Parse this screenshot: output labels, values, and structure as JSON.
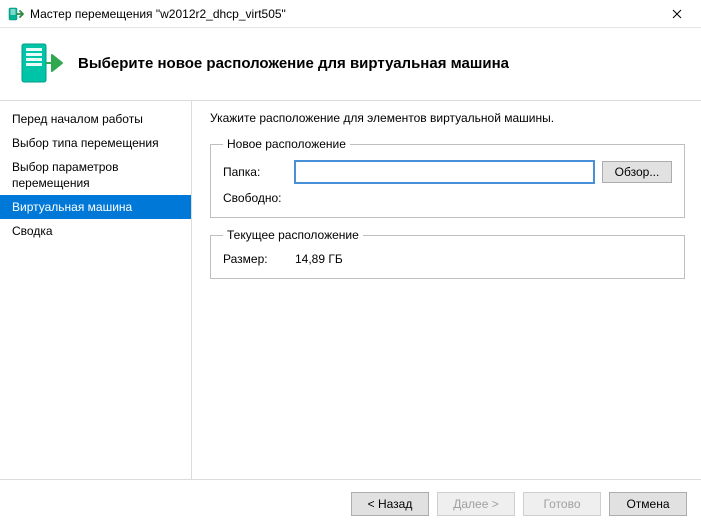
{
  "window": {
    "title": "Мастер перемещения \"w2012r2_dhcp_virt505\""
  },
  "header": {
    "title": "Выберите новое расположение для виртуальная машина"
  },
  "sidebar": {
    "steps": [
      {
        "label": "Перед началом работы"
      },
      {
        "label": "Выбор типа перемещения"
      },
      {
        "label": "Выбор параметров перемещения"
      },
      {
        "label": "Виртуальная машина"
      },
      {
        "label": "Сводка"
      }
    ],
    "activeIndex": 3
  },
  "content": {
    "instruction": "Укажите расположение для элементов виртуальной машины.",
    "newLocation": {
      "legend": "Новое расположение",
      "folderLabel": "Папка:",
      "folderValue": "",
      "browseLabel": "Обзор...",
      "freeLabel": "Свободно:",
      "freeValue": ""
    },
    "currentLocation": {
      "legend": "Текущее расположение",
      "sizeLabel": "Размер:",
      "sizeValue": "14,89 ГБ"
    }
  },
  "footer": {
    "back": "< Назад",
    "next": "Далее >",
    "finish": "Готово",
    "cancel": "Отмена"
  }
}
